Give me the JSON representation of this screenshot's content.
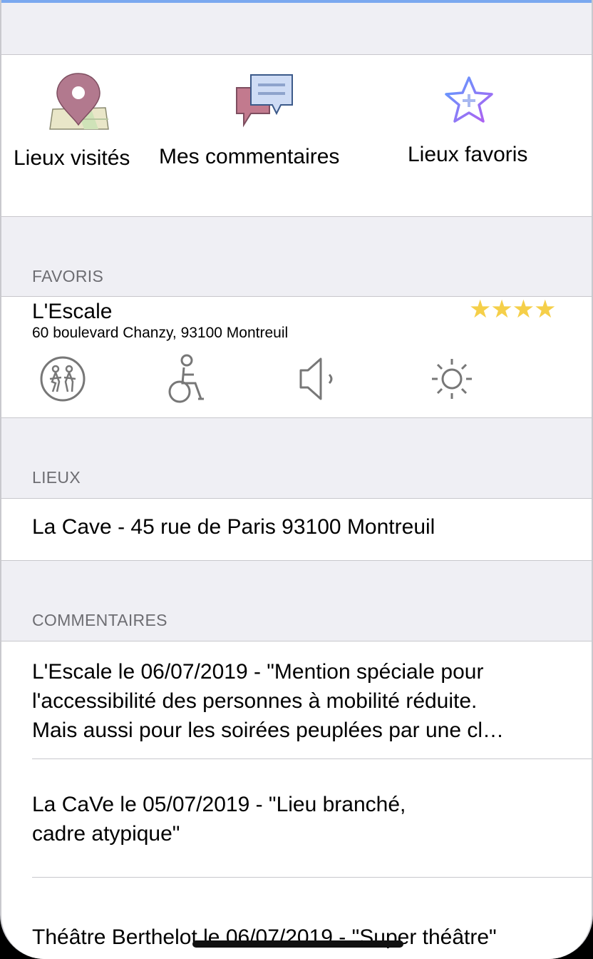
{
  "shortcuts": [
    {
      "label": "Lieux visités",
      "icon": "map-pin-icon"
    },
    {
      "label": "Mes commentaires",
      "icon": "speech-bubbles-icon"
    },
    {
      "label": "Lieux favoris",
      "icon": "star-plus-icon"
    }
  ],
  "favorites": {
    "header": "FAVORIS",
    "item": {
      "name": "L'Escale",
      "address": "60 boulevard Chanzy, 93100 Montreuil",
      "stars": "★★★★",
      "rating": 4,
      "amenities": [
        "family-icon",
        "wheelchair-icon",
        "speaker-icon",
        "sun-icon"
      ]
    }
  },
  "places": {
    "header": "LIEUX",
    "items": [
      "La Cave - 45 rue de Paris 93100 Montreuil"
    ]
  },
  "comments": {
    "header": "COMMENTAIRES",
    "items": [
      {
        "line1": "L'Escale le 06/07/2019 - \"Mention spéciale pour",
        "line2": "l'accessibilité des personnes à mobilité réduite.",
        "line3": "Mais aussi pour les soirées peuplées par une cl…"
      },
      {
        "line1": "La CaVe le 05/07/2019 - \"Lieu branché,",
        "line2": "cadre atypique\""
      },
      {
        "line1": "Théâtre Berthelot le 06/07/2019 - \"Super théâtre\""
      }
    ]
  },
  "colors": {
    "accent": "#7aa8ef",
    "star": "#f5cf49",
    "background": "#efeff4"
  }
}
